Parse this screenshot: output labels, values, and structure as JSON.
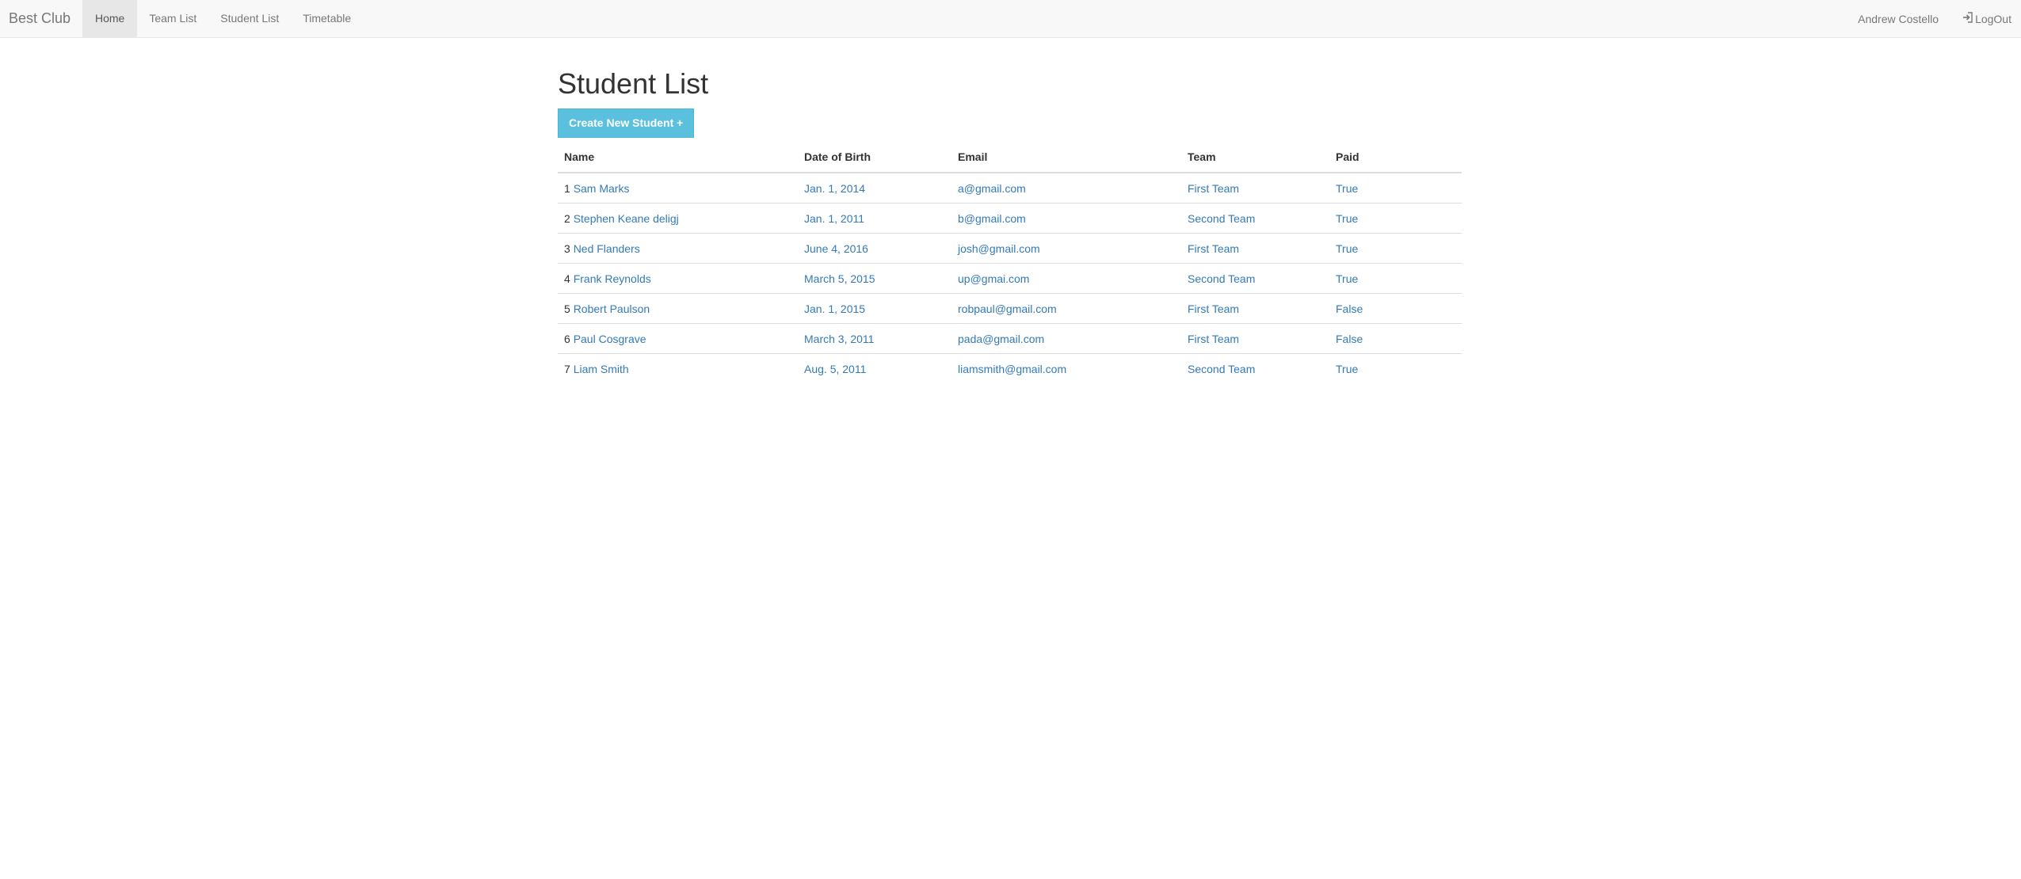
{
  "navbar": {
    "brand": "Best Club",
    "items": [
      {
        "label": "Home",
        "active": true
      },
      {
        "label": "Team List",
        "active": false
      },
      {
        "label": "Student List",
        "active": false
      },
      {
        "label": "Timetable",
        "active": false
      }
    ],
    "user": "Andrew Costello",
    "logout_label": "LogOut",
    "logout_icon": "log-in-icon"
  },
  "page": {
    "title": "Student List",
    "create_button_label": "Create New Student +"
  },
  "table": {
    "headers": [
      "Name",
      "Date of Birth",
      "Email",
      "Team",
      "Paid"
    ],
    "rows": [
      {
        "index": "1",
        "name": "Sam Marks",
        "dob": "Jan. 1, 2014",
        "email": "a@gmail.com",
        "team": "First Team",
        "paid": "True"
      },
      {
        "index": "2",
        "name": "Stephen Keane deligj",
        "dob": "Jan. 1, 2011",
        "email": "b@gmail.com",
        "team": "Second Team",
        "paid": "True"
      },
      {
        "index": "3",
        "name": "Ned Flanders",
        "dob": "June 4, 2016",
        "email": "josh@gmail.com",
        "team": "First Team",
        "paid": "True"
      },
      {
        "index": "4",
        "name": "Frank Reynolds",
        "dob": "March 5, 2015",
        "email": "up@gmai.com",
        "team": "Second Team",
        "paid": "True"
      },
      {
        "index": "5",
        "name": "Robert Paulson",
        "dob": "Jan. 1, 2015",
        "email": "robpaul@gmail.com",
        "team": "First Team",
        "paid": "False"
      },
      {
        "index": "6",
        "name": "Paul Cosgrave",
        "dob": "March 3, 2011",
        "email": "pada@gmail.com",
        "team": "First Team",
        "paid": "False"
      },
      {
        "index": "7",
        "name": "Liam Smith",
        "dob": "Aug. 5, 2011",
        "email": "liamsmith@gmail.com",
        "team": "Second Team",
        "paid": "True"
      }
    ]
  },
  "colors": {
    "link": "#337ab7",
    "button_bg": "#5bc0de",
    "navbar_bg": "#f8f8f8",
    "active_nav_bg": "#e7e7e7"
  }
}
